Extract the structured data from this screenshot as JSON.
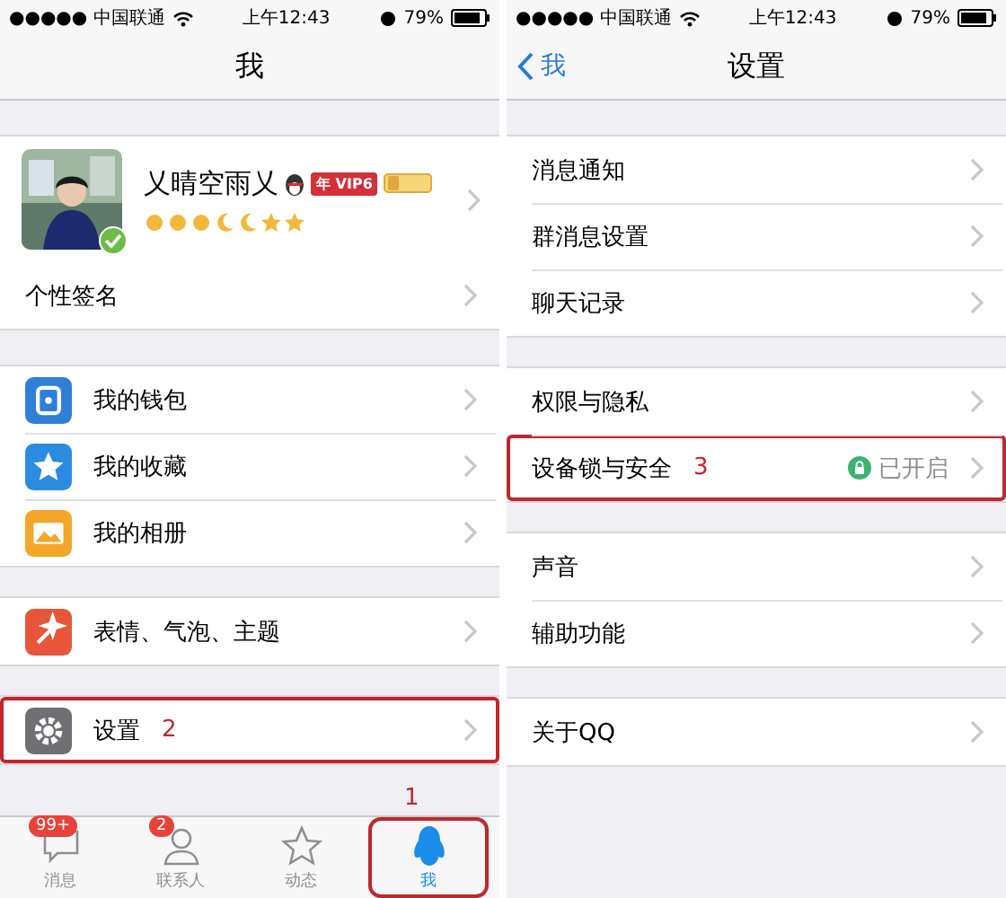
{
  "left_screen": {
    "status_bar": {
      "carrier": "●●●●● 中国联通",
      "time": "上午12:43",
      "battery": "79%"
    },
    "nav": {
      "title": "我"
    },
    "profile": {
      "name": "乂晴空雨乂",
      "vip_badge": "年 VIP6",
      "signature": "个性签名"
    },
    "menu_sections": [
      [
        {
          "label": "我的钱包",
          "color": "#2f7fd9"
        },
        {
          "label": "我的收藏",
          "color": "#2a8be0"
        },
        {
          "label": "我的相册",
          "color": "#f2a62a"
        }
      ],
      [
        {
          "label": "表情、气泡、主题",
          "color": "#e8553a"
        }
      ],
      [
        {
          "label": "设置",
          "color": "#6f6f74",
          "annotation": "2"
        }
      ]
    ],
    "tab_bar": [
      {
        "label": "消息",
        "badge": "99+",
        "selected": false
      },
      {
        "label": "联系人",
        "badge": "2",
        "selected": false
      },
      {
        "label": "动态",
        "selected": false
      },
      {
        "label": "我",
        "selected": true,
        "annotation": "1"
      }
    ]
  },
  "right_screen": {
    "status_bar": {
      "carrier": "●●●●● 中国联通",
      "time": "上午12:43",
      "battery": "79%"
    },
    "nav": {
      "back": "我",
      "title": "设置"
    },
    "sections": [
      [
        {
          "label": "消息通知"
        },
        {
          "label": "群消息设置"
        },
        {
          "label": "聊天记录"
        }
      ],
      [
        {
          "label": "权限与隐私"
        },
        {
          "label": "设备锁与安全",
          "value": "已开启",
          "annotation": "3"
        }
      ],
      [
        {
          "label": "声音"
        },
        {
          "label": "辅助功能"
        }
      ],
      [
        {
          "label": "关于QQ"
        }
      ]
    ]
  }
}
